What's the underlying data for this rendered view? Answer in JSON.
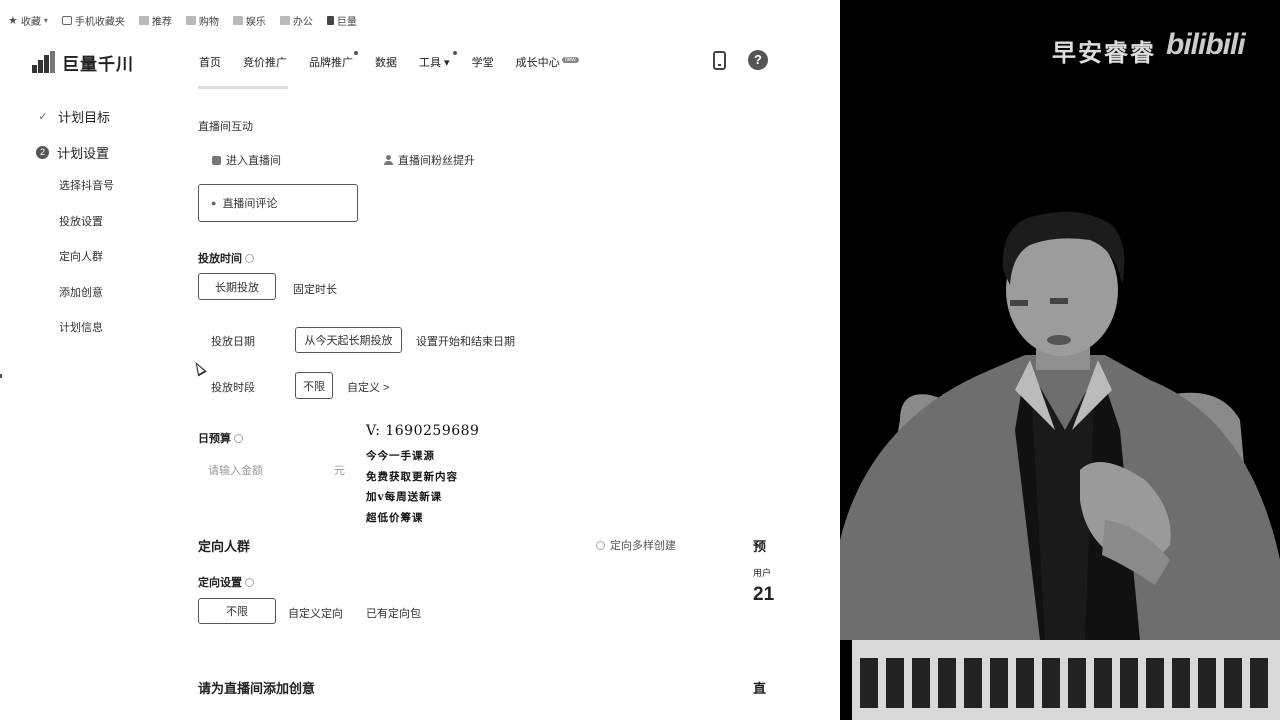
{
  "bookmarks": [
    {
      "label": "收藏",
      "icon": "star-icon"
    },
    {
      "label": "手机收藏夹",
      "icon": "phone-icon"
    },
    {
      "label": "推荐",
      "icon": "folder-icon"
    },
    {
      "label": "购物",
      "icon": "folder-icon"
    },
    {
      "label": "娱乐",
      "icon": "folder-icon"
    },
    {
      "label": "办公",
      "icon": "folder-icon"
    },
    {
      "label": "巨量",
      "icon": "app-icon"
    }
  ],
  "app": {
    "name": "巨量千川"
  },
  "nav": [
    {
      "label": "首页",
      "dot": false,
      "badge": ""
    },
    {
      "label": "竞价推广",
      "dot": false,
      "badge": ""
    },
    {
      "label": "品牌推广",
      "dot": true,
      "badge": ""
    },
    {
      "label": "数据",
      "dot": false,
      "badge": ""
    },
    {
      "label": "工具 ▾",
      "dot": true,
      "badge": ""
    },
    {
      "label": "学堂",
      "dot": false,
      "badge": ""
    },
    {
      "label": "成长中心",
      "dot": false,
      "badge": "new"
    }
  ],
  "left_menu": {
    "step1": "计划目标",
    "step2": "计划设置",
    "step2_num": "2",
    "subs": [
      "选择抖音号",
      "投放设置",
      "定向人群",
      "添加创意",
      "计划信息"
    ]
  },
  "form": {
    "interaction_label": "直播间互动",
    "opt_enter": "进入直播间",
    "opt_fans": "直播间粉丝提升",
    "opt_comment": "直播间评论",
    "time_label": "投放时间",
    "time_long": "长期投放",
    "time_fixed": "固定时长",
    "date_label": "投放日期",
    "date_from_today": "从今天起长期投放",
    "date_set": "设置开始和结束日期",
    "period_label": "投放时段",
    "period_unlimited": "不限",
    "period_custom": "自定义 >",
    "budget_label": "日预算",
    "budget_placeholder": "请输入金额",
    "budget_unit": "元",
    "targeting_title": "定向人群",
    "targeting_multi": "定向多样创建",
    "targeting_setting_label": "定向设置",
    "target_unlimited": "不限",
    "target_custom": "自定义定向",
    "target_existing": "已有定向包",
    "creative_title": "请为直播间添加创意",
    "right_cut1": "预",
    "right_cut2": "用户",
    "right_cut3": "21",
    "right_cut4": "直"
  },
  "promo": {
    "contact": "V: 1690259689",
    "lines": [
      "今今一手课源",
      "免费获取更新内容",
      "加v每周送新课",
      "超低价筹课"
    ]
  },
  "video": {
    "watermark_text": "早安睿睿",
    "watermark_logo": "bilibili"
  }
}
